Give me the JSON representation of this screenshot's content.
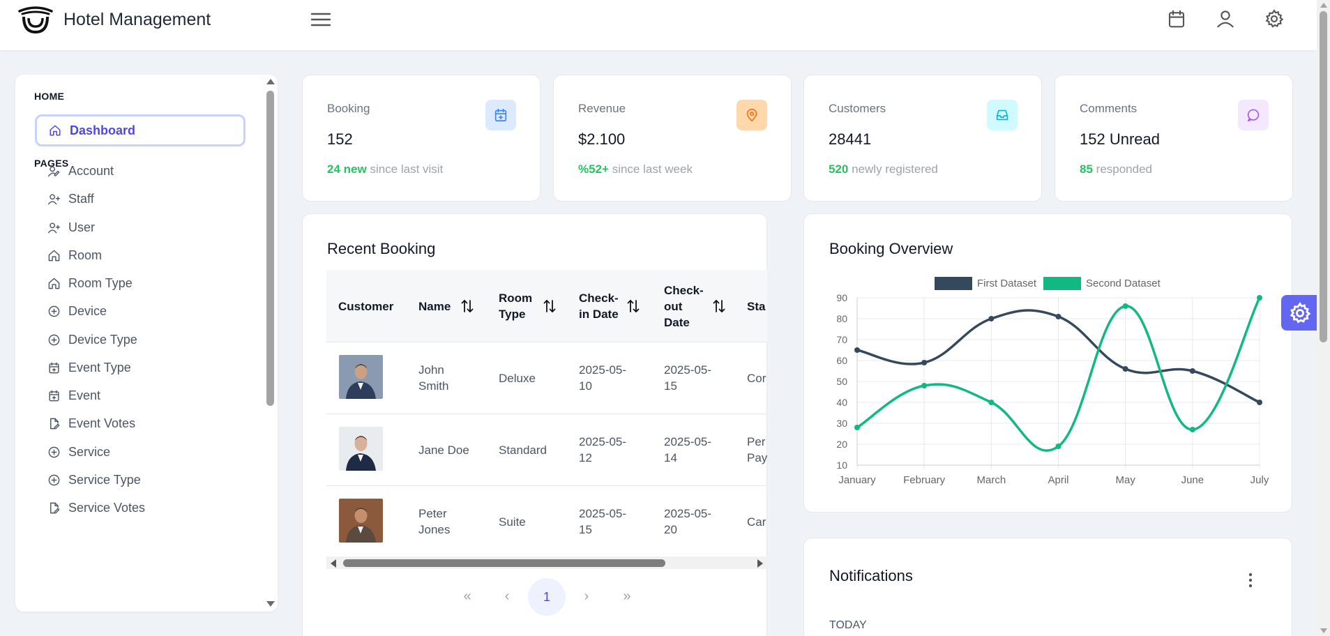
{
  "app": {
    "title": "Hotel Management"
  },
  "sidebar": {
    "home_section": "HOME",
    "active_item": "Dashboard",
    "pages_section": "PAGES",
    "items": [
      {
        "label": "Account",
        "icon": "user-edit-icon"
      },
      {
        "label": "Staff",
        "icon": "user-plus-icon"
      },
      {
        "label": "User",
        "icon": "user-plus-icon"
      },
      {
        "label": "Room",
        "icon": "home-icon"
      },
      {
        "label": "Room Type",
        "icon": "home-icon"
      },
      {
        "label": "Device",
        "icon": "plus-circle-icon"
      },
      {
        "label": "Device Type",
        "icon": "plus-circle-icon"
      },
      {
        "label": "Event Type",
        "icon": "calendar-plus-icon"
      },
      {
        "label": "Event",
        "icon": "calendar-plus-icon"
      },
      {
        "label": "Event Votes",
        "icon": "file-edit-icon"
      },
      {
        "label": "Service",
        "icon": "plus-circle-icon"
      },
      {
        "label": "Service Type",
        "icon": "plus-circle-icon"
      },
      {
        "label": "Service Votes",
        "icon": "file-edit-icon"
      }
    ]
  },
  "stats": [
    {
      "label": "Booking",
      "value": "152",
      "highlight": "24 new",
      "sub": "since last visit",
      "icon": "calendar-plus-icon",
      "icon_bg": "#dbeafe",
      "icon_color": "#3b82f6"
    },
    {
      "label": "Revenue",
      "value": "$2.100",
      "highlight": "%52+",
      "sub": "since last week",
      "icon": "map-pin-icon",
      "icon_bg": "#fed7aa",
      "icon_color": "#f97316"
    },
    {
      "label": "Customers",
      "value": "28441",
      "highlight": "520",
      "sub": "newly registered",
      "icon": "inbox-icon",
      "icon_bg": "#cffafe",
      "icon_color": "#06b6d4"
    },
    {
      "label": "Comments",
      "value": "152 Unread",
      "highlight": "85",
      "sub": "responded",
      "icon": "message-circle-icon",
      "icon_bg": "#f3e8ff",
      "icon_color": "#a855f7"
    }
  ],
  "recent_booking": {
    "title": "Recent Booking",
    "columns": [
      {
        "lines": [
          "Customer"
        ]
      },
      {
        "lines": [
          "Name"
        ]
      },
      {
        "lines": [
          "Room",
          "Type"
        ]
      },
      {
        "lines": [
          "Check-",
          "in Date"
        ]
      },
      {
        "lines": [
          "Check-",
          "out",
          "Date"
        ]
      },
      {
        "lines": [
          "Sta"
        ]
      }
    ],
    "rows": [
      {
        "name": [
          "John",
          "Smith"
        ],
        "room_type": "Deluxe",
        "check_in": [
          "2025-05-",
          "10"
        ],
        "check_out": [
          "2025-05-",
          "15"
        ],
        "status": [
          "Cor"
        ]
      },
      {
        "name": [
          "Jane Doe"
        ],
        "room_type": "Standard",
        "check_in": [
          "2025-05-",
          "12"
        ],
        "check_out": [
          "2025-05-",
          "14"
        ],
        "status": [
          "Per",
          "Pay"
        ]
      },
      {
        "name": [
          "Peter",
          "Jones"
        ],
        "room_type": "Suite",
        "check_in": [
          "2025-05-",
          "15"
        ],
        "check_out": [
          "2025-05-",
          "20"
        ],
        "status": [
          "Car"
        ]
      }
    ],
    "pager": {
      "first": "«",
      "prev": "‹",
      "page": "1",
      "next": "›",
      "last": "»"
    }
  },
  "booking_overview": {
    "title": "Booking Overview"
  },
  "chart_data": {
    "type": "line",
    "x": [
      "January",
      "February",
      "March",
      "April",
      "May",
      "June",
      "July"
    ],
    "series": [
      {
        "name": "First Dataset",
        "values": [
          65,
          59,
          80,
          81,
          56,
          55,
          40
        ],
        "color": "#34495e"
      },
      {
        "name": "Second Dataset",
        "values": [
          28,
          48,
          40,
          19,
          86,
          27,
          90
        ],
        "color": "#10b981"
      }
    ],
    "ylim": [
      10,
      90
    ],
    "yticks": [
      10,
      20,
      30,
      40,
      50,
      60,
      70,
      80,
      90
    ],
    "grid": true,
    "legend": "top"
  },
  "notifications": {
    "title": "Notifications",
    "today_label": "TODAY"
  },
  "colors": {
    "accent": "#6366f1",
    "positive": "#22c55e"
  }
}
